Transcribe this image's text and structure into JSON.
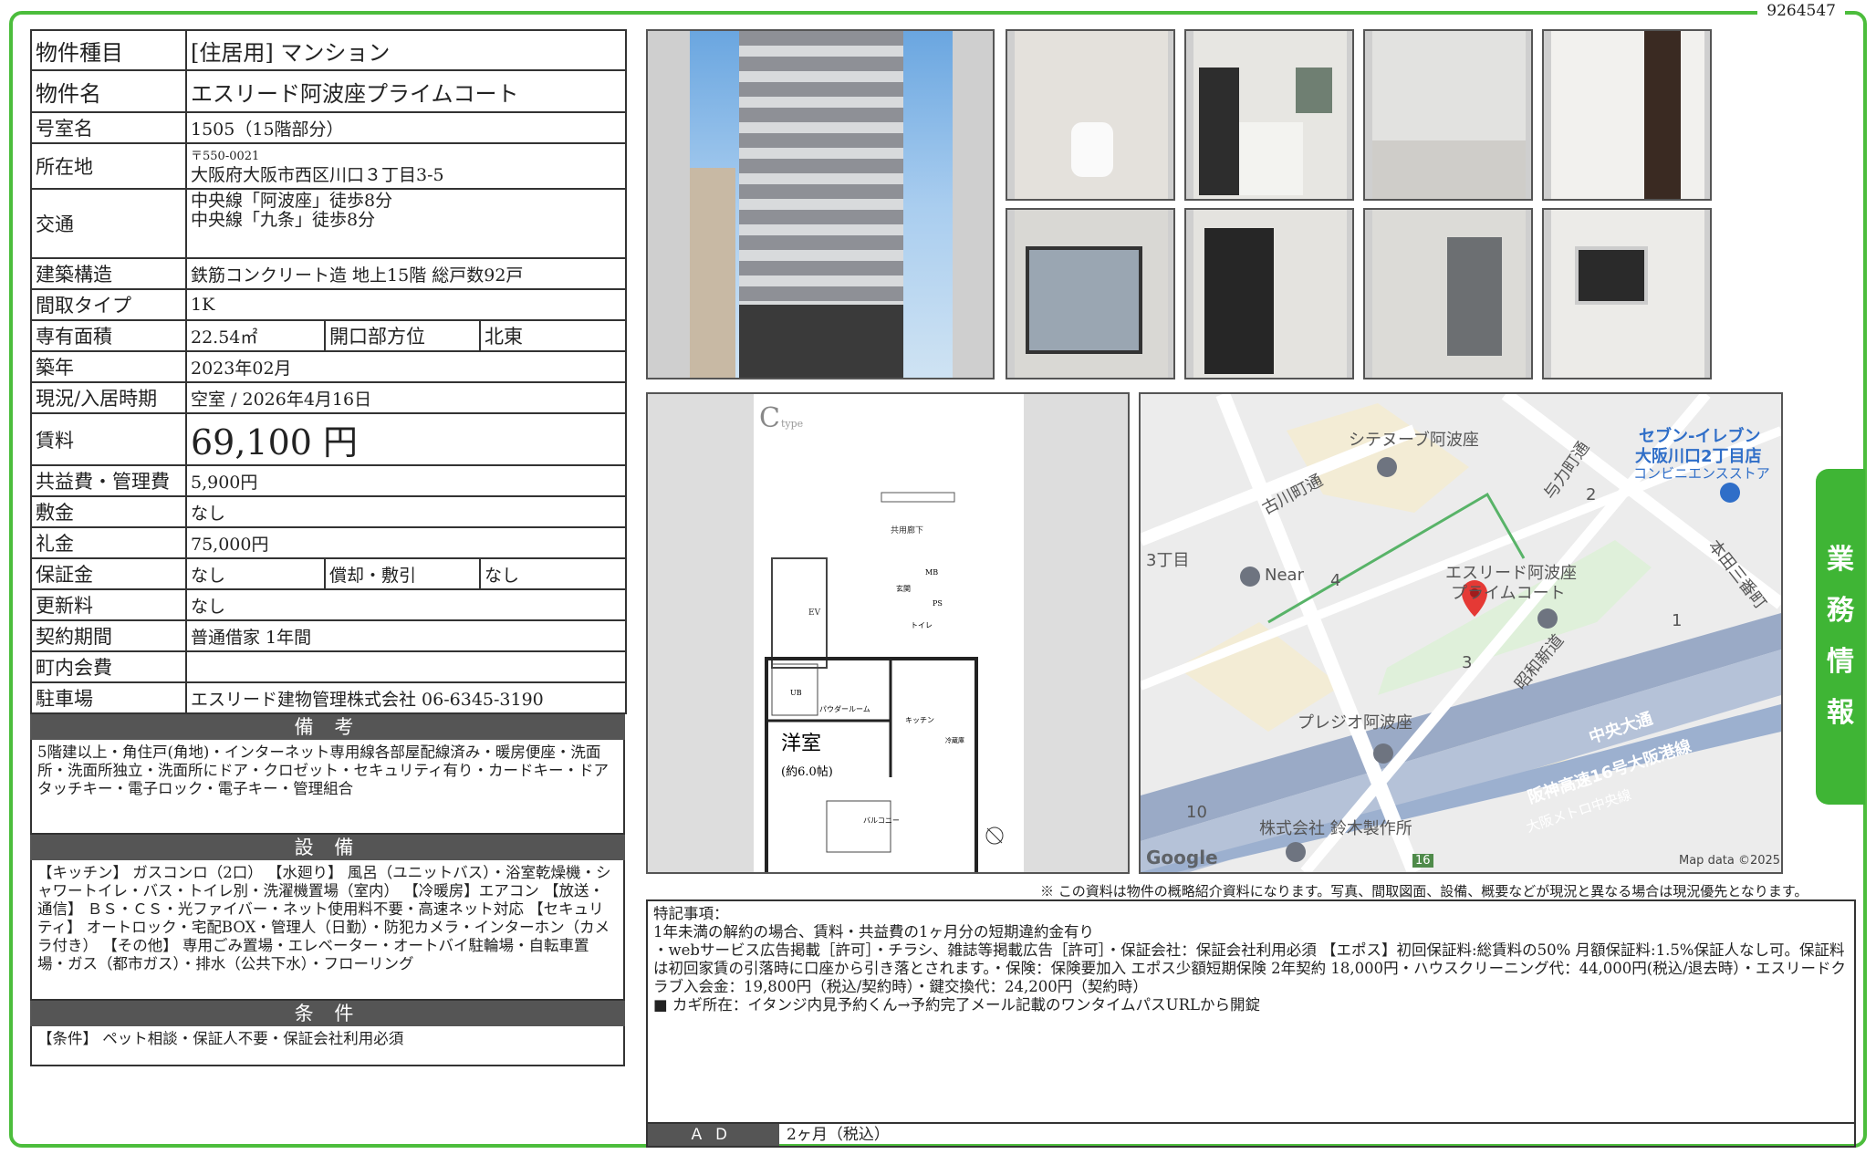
{
  "doc_id": "9264547",
  "side_tab": [
    "業",
    "務",
    "情",
    "報"
  ],
  "property": {
    "type_label": "物件種目",
    "type_value": "[住居用] マンション",
    "name_label": "物件名",
    "name_value": "エスリード阿波座プライムコート",
    "room_label": "号室名",
    "room_value": "1505（15階部分）",
    "addr_label": "所在地",
    "addr_zip": "〒550-0021",
    "addr_value": "大阪府大阪市西区川口３丁目3-5",
    "access_label": "交通",
    "access_line1": "中央線「阿波座」徒歩8分",
    "access_line2": "中央線「九条」徒歩8分",
    "structure_label": "建築構造",
    "structure_value": "鉄筋コンクリート造 地上15階 総戸数92戸",
    "layout_label": "間取タイプ",
    "layout_value": "1K",
    "area_label": "専有面積",
    "area_value": "22.54㎡",
    "direction_label": "開口部方位",
    "direction_value": "北東",
    "built_label": "築年",
    "built_value": "2023年02月",
    "status_label": "現況/入居時期",
    "status_value": "空室 / 2026年4月16日",
    "rent_label": "賃料",
    "rent_value": "69,100 円",
    "fee_label": "共益費・管理費",
    "fee_value": "5,900円",
    "deposit_label": "敷金",
    "deposit_value": "なし",
    "key_money_label": "礼金",
    "key_money_value": "75,000円",
    "guarantee_label": "保証金",
    "guarantee_value": "なし",
    "amort_label": "償却・敷引",
    "amort_value": "なし",
    "renewal_label": "更新料",
    "renewal_value": "なし",
    "contract_label": "契約期間",
    "contract_value": "普通借家 1年間",
    "town_fee_label": "町内会費",
    "town_fee_value": "",
    "parking_label": "駐車場",
    "parking_value": "エスリード建物管理株式会社 06-6345-3190"
  },
  "remarks": {
    "title": "備 考",
    "text": "5階建以上・角住戸(角地)・インターネット専用線各部屋配線済み・暖房便座・洗面所・洗面所独立・洗面所にドア・クロゼット・セキュリティ有り・カードキー・ドアタッチキー・電子ロック・電子キー・管理組合"
  },
  "equipment": {
    "title": "設 備",
    "text": "【キッチン】 ガスコンロ（2口） 【水廻り】 風呂（ユニットバス）・浴室乾燥機・シャワートイレ・バス・トイレ別・洗濯機置場（室内） 【冷暖房】エアコン 【放送・通信】 ＢＳ・ＣＳ・光ファイバー・ネット使用料不要・高速ネット対応 【セキュリティ】 オートロック・宅配BOX・管理人（日勤）・防犯カメラ・インターホン（カメラ付き） 【その他】 専用ごみ置場・エレベーター・オートバイ駐輪場・自転車置場・ガス（都市ガス）・排水（公共下水）・フローリング"
  },
  "conditions": {
    "title": "条 件",
    "text": "【条件】 ペット相談・保証人不要・保証会社利用必須"
  },
  "floorplan": {
    "type_mark": "C",
    "type_sub": "type",
    "room_name": "洋室",
    "room_size": "(約6.0帖)",
    "labels": [
      "共用廊下",
      "EV",
      "玄関",
      "MB",
      "PS",
      "トイレ",
      "UB",
      "パウダールーム",
      "キッチン",
      "冷蔵庫",
      "バルコニー"
    ]
  },
  "map": {
    "labels": [
      "シテヌーブ阿波座",
      "セブン-イレブン",
      "大阪川口2丁目店",
      "コンビニエンスストア",
      "古川町通",
      "与力町通",
      "3丁目",
      "Near",
      "エスリード阿波座",
      "プライムコート",
      "本田三番町",
      "昭和新道",
      "プレジオ阿波座",
      "中央大通",
      "阪神高速16号大阪港線",
      "大阪メトロ中央線",
      "株式会社 鈴木製作所",
      "2",
      "4",
      "1",
      "3",
      "10",
      "16"
    ],
    "google": "Google",
    "attribution": "Map data ©2025"
  },
  "disclaimer": "※ この資料は物件の概略紹介資料になります。写真、間取図面、設備、概要などが現況と異なる場合は現況優先となります。",
  "special": {
    "title": "特記事項：",
    "line1": "1年未満の解約の場合、賃料・共益費の1ヶ月分の短期違約金有り",
    "line2": "・webサービス広告掲載［許可］・チラシ、雑誌等掲載広告［許可］・保証会社：保証会社利用必須 【エポス】初回保証料:総賃料の50% 月額保証料:1.5%保証人なし可。保証料は初回家賃の引落時に口座から引き落とされます。・保険：保険要加入 エポス少額短期保険 2年契約 18,000円・ハウスクリーニング代：44,000円(税込/退去時）・エスリードクラブ入会金：19,800円（税込/契約時）・鍵交換代：24,200円（契約時）",
    "line3": "■ カギ所在：イタンジ内見予約くん→予約完了メール記載のワンタイムパスURLから開錠"
  },
  "ad": {
    "label": "ＡＤ",
    "value": "2ヶ月（税込）"
  }
}
